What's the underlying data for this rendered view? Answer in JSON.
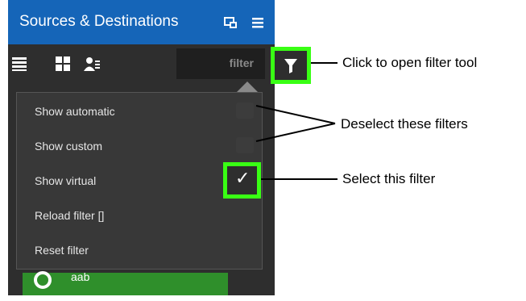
{
  "panel": {
    "title": "Sources & Destinations",
    "filter_placeholder": "filter"
  },
  "menu": {
    "items": [
      {
        "label": "Show automatic",
        "checked": false
      },
      {
        "label": "Show custom",
        "checked": false
      },
      {
        "label": "Show virtual",
        "checked": true
      },
      {
        "label": "Reload filter []"
      },
      {
        "label": "Reset filter"
      }
    ]
  },
  "list_item": {
    "label": "aab"
  },
  "annotations": {
    "open_filter": "Click to open filter tool",
    "deselect": "Deselect these filters",
    "select": "Select this filter"
  },
  "colors": {
    "title_bar": "#1565b8",
    "panel_bg": "#2e2e2e",
    "highlight": "#39ff14",
    "list_item_bg": "#2f8f2b"
  }
}
